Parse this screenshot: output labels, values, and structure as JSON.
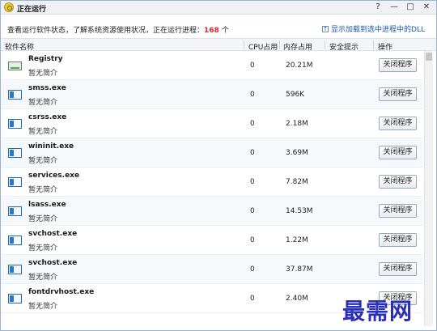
{
  "window": {
    "title": "正在运行",
    "controls": {
      "help": "?",
      "minimize": "—",
      "maximize": "□",
      "close": "✕"
    }
  },
  "status": {
    "prefix": "查看运行软件状态，了解系统资源使用状况，正在运行进程：",
    "count": "168",
    "unit": "个",
    "dll_icon": "↑",
    "dll_toggle_label": "显示加载到选中进程中的DLL"
  },
  "table": {
    "headers": {
      "name": "软件名称",
      "cpu": "CPU占用",
      "memory": "内存占用",
      "security": "安全提示",
      "action": "操作"
    },
    "rows": [
      {
        "icon": "drive-icon",
        "name": "Registry",
        "desc": "暂无简介",
        "cpu": "0",
        "memory": "20.21M",
        "security": "",
        "action": "关闭程序"
      },
      {
        "icon": "window-app-icon",
        "name": "smss.exe",
        "desc": "暂无简介",
        "cpu": "0",
        "memory": "596K",
        "security": "",
        "action": "关闭程序"
      },
      {
        "icon": "window-app-icon",
        "name": "csrss.exe",
        "desc": "暂无简介",
        "cpu": "0",
        "memory": "2.18M",
        "security": "",
        "action": "关闭程序"
      },
      {
        "icon": "window-app-icon",
        "name": "wininit.exe",
        "desc": "暂无简介",
        "cpu": "0",
        "memory": "3.69M",
        "security": "",
        "action": "关闭程序"
      },
      {
        "icon": "window-app-icon",
        "name": "services.exe",
        "desc": "暂无简介",
        "cpu": "0",
        "memory": "7.82M",
        "security": "",
        "action": "关闭程序"
      },
      {
        "icon": "window-app-icon",
        "name": "lsass.exe",
        "desc": "暂无简介",
        "cpu": "0",
        "memory": "14.53M",
        "security": "",
        "action": "关闭程序"
      },
      {
        "icon": "window-app-icon",
        "name": "svchost.exe",
        "desc": "暂无简介",
        "cpu": "0",
        "memory": "1.22M",
        "security": "",
        "action": "关闭程序"
      },
      {
        "icon": "window-app-icon",
        "name": "svchost.exe",
        "desc": "暂无简介",
        "cpu": "0",
        "memory": "37.87M",
        "security": "",
        "action": "关闭程序"
      },
      {
        "icon": "window-app-icon",
        "name": "fontdrvhost.exe",
        "desc": "暂无简介",
        "cpu": "0",
        "memory": "2.40M",
        "security": "",
        "action": "关闭程序"
      }
    ]
  },
  "watermark": "最需网"
}
